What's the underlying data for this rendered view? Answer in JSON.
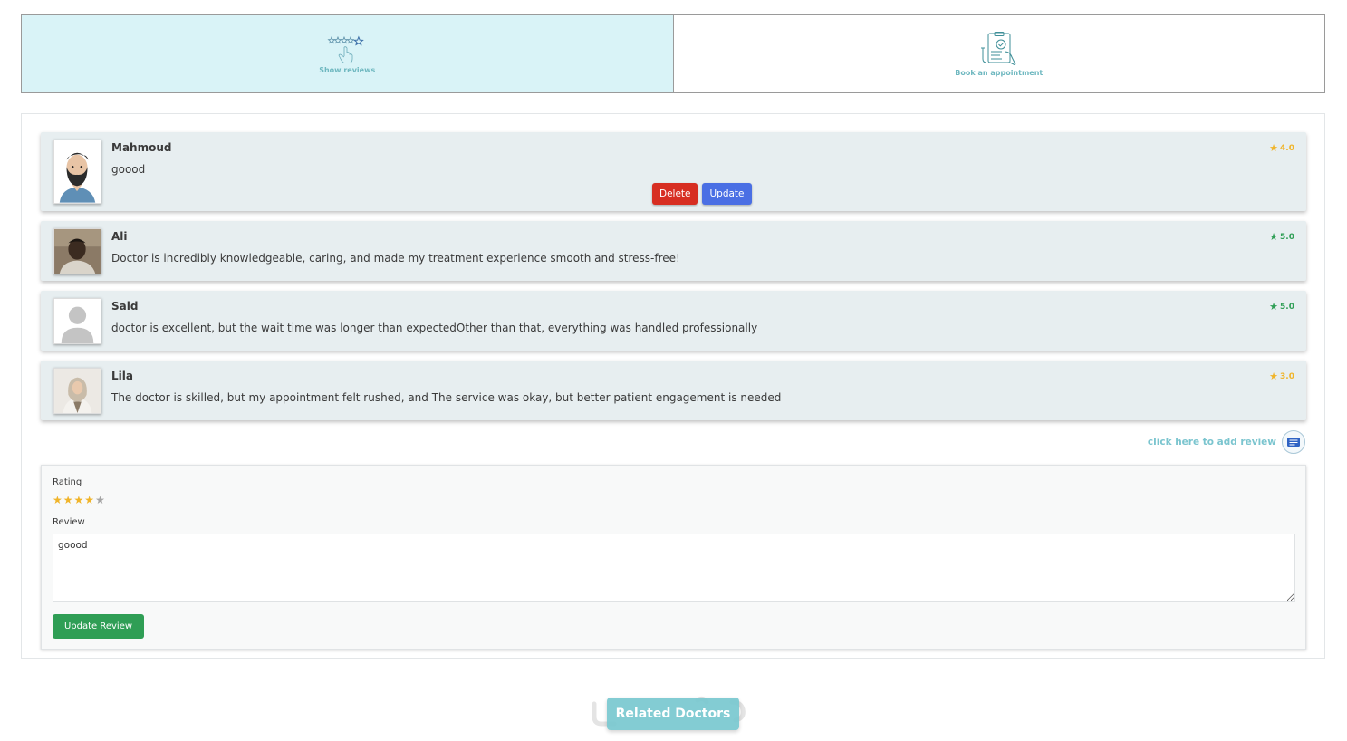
{
  "tabs": [
    {
      "label": "Show reviews",
      "icon": "rating-stars-hand-icon",
      "active": true
    },
    {
      "label": "Book an appointment",
      "icon": "clipboard-doctor-icon",
      "active": false
    }
  ],
  "reviews": [
    {
      "name": "Mahmoud",
      "text": "goood",
      "rating": "4.0",
      "rating_color": "gold",
      "avatar": "avatar-bearded-man"
    },
    {
      "name": "Ali",
      "text": "Doctor is incredibly knowledgeable, caring, and made my treatment experience smooth and stress-free!",
      "rating": "5.0",
      "rating_color": "green",
      "avatar": "avatar-photo-man"
    },
    {
      "name": "Said",
      "text": "doctor is excellent, but the wait time was longer than expectedOther than that, everything was handled professionally",
      "rating": "5.0",
      "rating_color": "green",
      "avatar": "avatar-placeholder"
    },
    {
      "name": "Lila",
      "text": "The doctor is skilled, but my appointment felt rushed, and The service was okay, but better patient engagement is needed",
      "rating": "3.0",
      "rating_color": "gold",
      "avatar": "avatar-photo-woman"
    }
  ],
  "review_actions": {
    "delete_label": "Delete",
    "update_label": "Update"
  },
  "add_review": {
    "label": "click here to add review",
    "icon": "add-review-icon"
  },
  "form": {
    "rating_label": "Rating",
    "rating_value": 4,
    "rating_max": 5,
    "review_label": "Review",
    "review_value": "goood",
    "submit_label": "Update Review"
  },
  "related": {
    "label": "Related Doctors"
  },
  "colors": {
    "active_tab": "#d9f3f7",
    "card_bg": "#e7eef0",
    "delete": "#d72e22",
    "update": "#4a6fe4",
    "submit": "#2f9e55",
    "gold": "#f0b429",
    "teal": "#79c8d0"
  }
}
